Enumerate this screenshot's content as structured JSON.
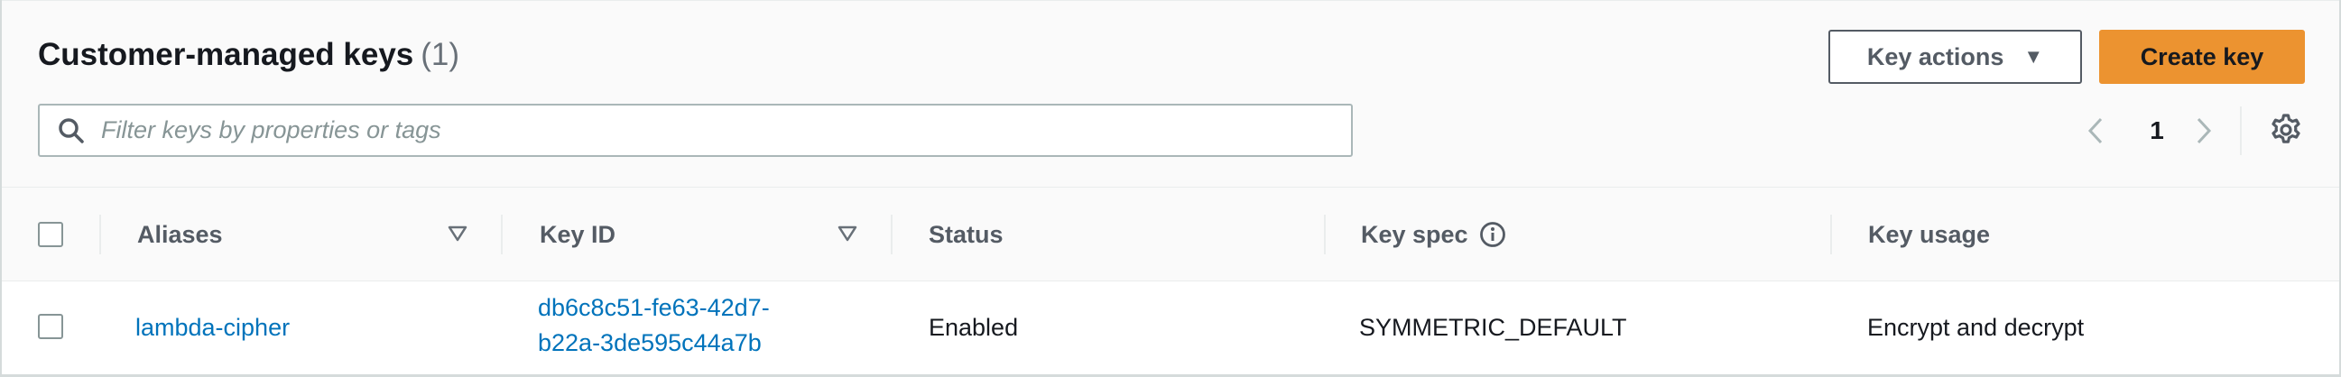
{
  "header": {
    "title": "Customer-managed keys",
    "count": "(1)",
    "key_actions_label": "Key actions",
    "create_key_label": "Create key"
  },
  "search": {
    "placeholder": "Filter keys by properties or tags",
    "value": ""
  },
  "pagination": {
    "current_page": "1"
  },
  "table": {
    "columns": [
      "Aliases",
      "Key ID",
      "Status",
      "Key spec",
      "Key usage"
    ],
    "rows": [
      {
        "alias": "lambda-cipher",
        "key_id_line1": "db6c8c51-fe63-42d7-",
        "key_id_line2": "b22a-3de595c44a7b",
        "status": "Enabled",
        "key_spec": "SYMMETRIC_DEFAULT",
        "key_usage": "Encrypt and decrypt"
      }
    ]
  },
  "colors": {
    "primary_button": "#ec9330",
    "link": "#0073bb",
    "header_bg": "#fafafa",
    "border": "#aab7b8"
  },
  "icons": {
    "search": "search-icon",
    "caret": "caret-down-icon",
    "prev": "chevron-left-icon",
    "next": "chevron-right-icon",
    "settings": "gear-icon",
    "sort": "sort-down-icon",
    "info": "info-icon"
  }
}
